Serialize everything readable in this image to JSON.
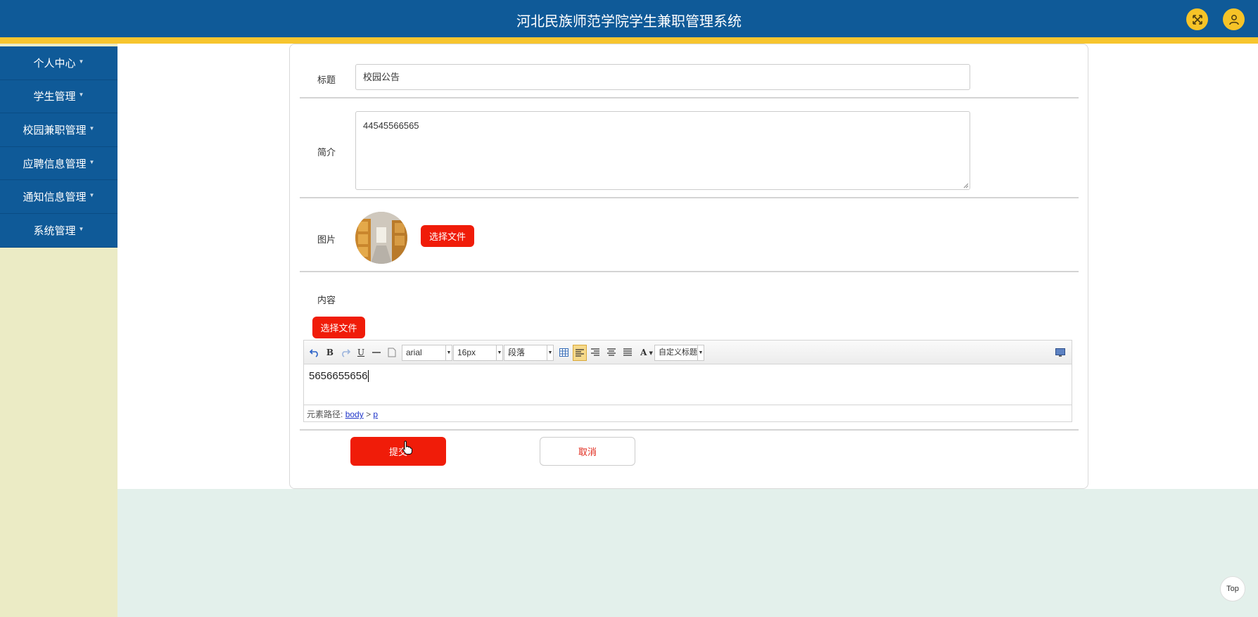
{
  "header": {
    "title": "河北民族师范学院学生兼职管理系统"
  },
  "sidebar": {
    "items": [
      {
        "label": "个人中心"
      },
      {
        "label": "学生管理"
      },
      {
        "label": "校园兼职管理"
      },
      {
        "label": "应聘信息管理"
      },
      {
        "label": "通知信息管理"
      },
      {
        "label": "系统管理"
      }
    ]
  },
  "form": {
    "title_label": "标题",
    "title_value": "校园公告",
    "intro_label": "简介",
    "intro_value": "44545566565",
    "image_label": "图片",
    "choose_file": "选择文件",
    "content_label": "内容",
    "content_choose_file": "选择文件",
    "submit_label": "提交",
    "cancel_label": "取消"
  },
  "editor": {
    "font_family": "arial",
    "font_size": "16px",
    "paragraph": "段落",
    "custom_title": "自定义标题",
    "content": "5656655656",
    "path_label": "元素路径:",
    "path_body": "body",
    "path_sep": ">",
    "path_p": "p"
  },
  "misc": {
    "top_label": "Top"
  },
  "colors": {
    "primary_blue": "#0f5a98",
    "accent_yellow": "#f7c52e",
    "button_red": "#f01c09",
    "sidebar_bg": "#ebebc5",
    "page_bg": "#e3f0eb"
  }
}
